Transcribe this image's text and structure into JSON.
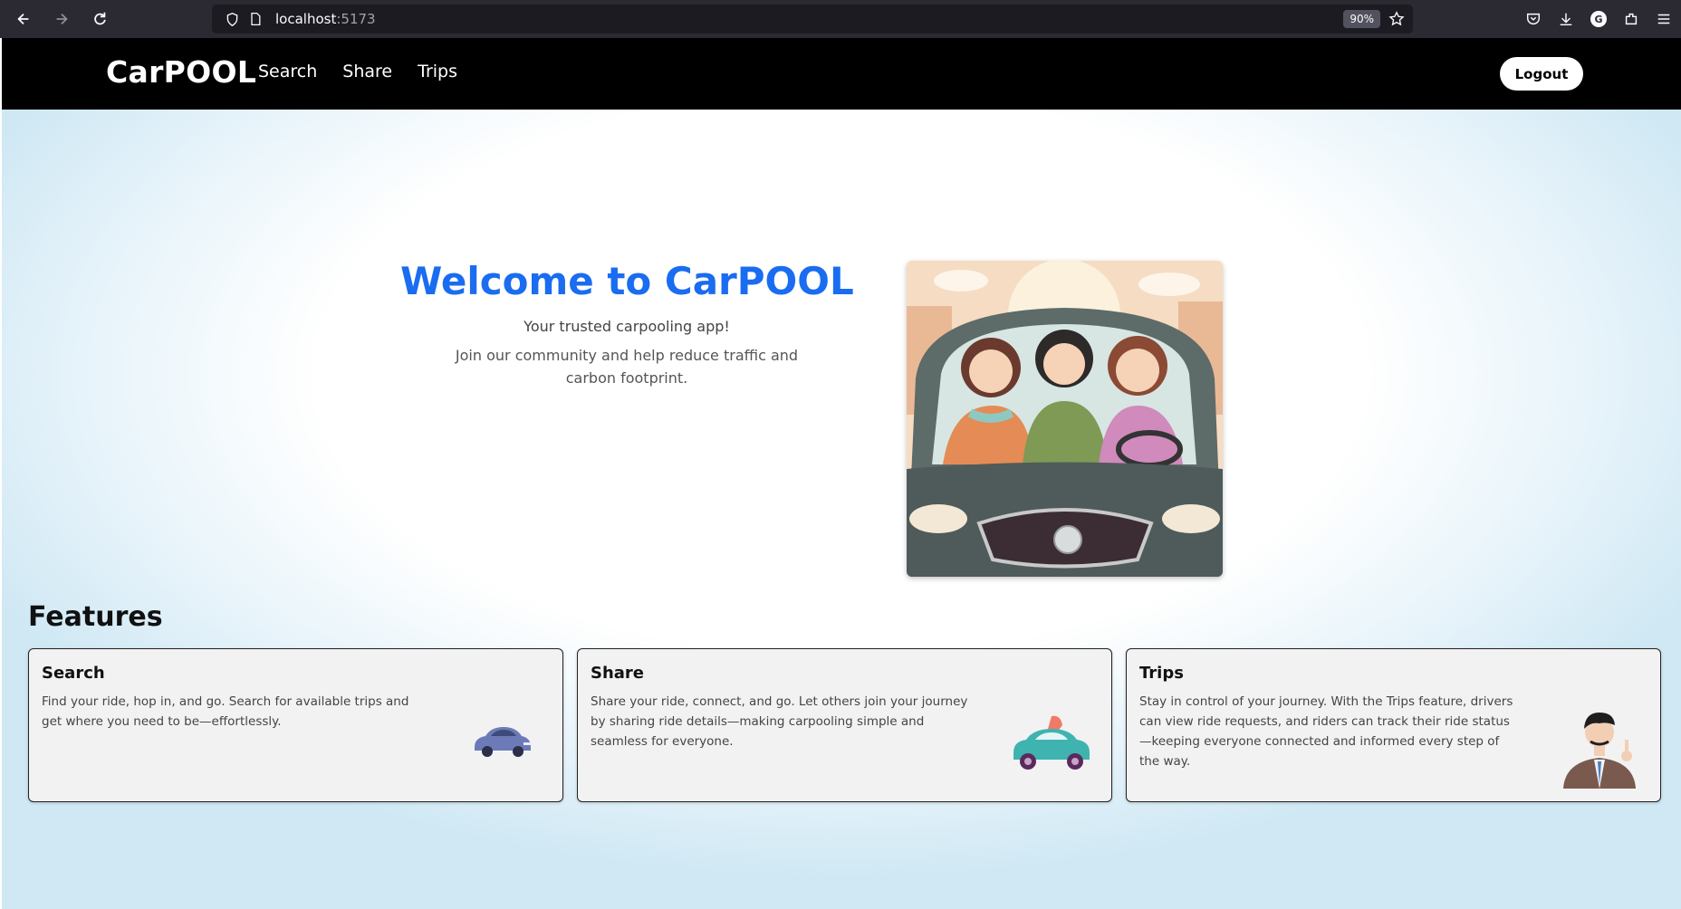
{
  "browser": {
    "url_host": "localhost",
    "url_port": ":5173",
    "zoom": "90%",
    "profile_initial": "G"
  },
  "navbar": {
    "brand": "CarPOOL",
    "links": [
      "Search",
      "Share",
      "Trips"
    ],
    "logout_label": "Logout"
  },
  "hero": {
    "title": "Welcome to CarPOOL",
    "subtitle": "Your trusted carpooling app!",
    "description": "Join our community and help reduce traffic and carbon footprint."
  },
  "features": {
    "heading": "Features",
    "cards": [
      {
        "title": "Search",
        "description": "Find your ride, hop in, and go. Search for available trips and get where you need to be—effortlessly.",
        "icon": "car-icon"
      },
      {
        "title": "Share",
        "description": "Share your ride, connect, and go. Let others join your journey by sharing ride details—making carpooling simple and seamless for everyone.",
        "icon": "share-car-icon"
      },
      {
        "title": "Trips",
        "description": "Stay in control of your journey. With the Trips feature, drivers can view ride requests, and riders can track their ride status—keeping everyone connected and informed every step of the way.",
        "icon": "businessman-icon"
      }
    ]
  }
}
